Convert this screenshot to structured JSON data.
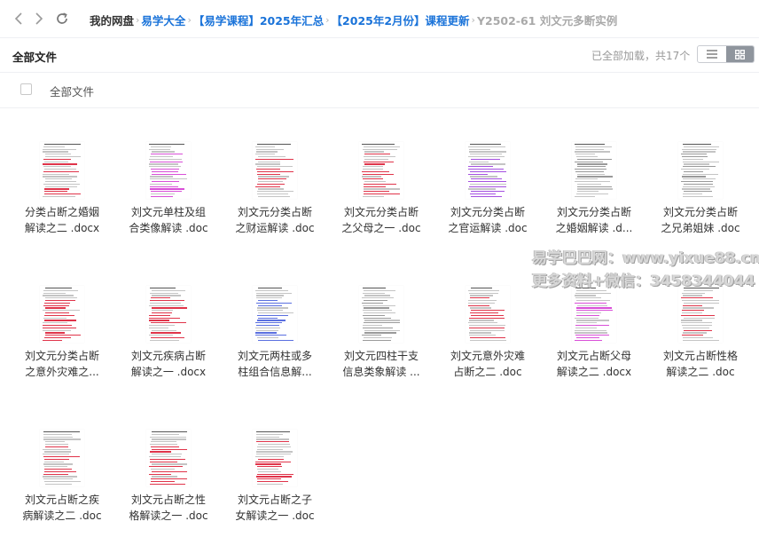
{
  "breadcrumb": [
    {
      "label": "我的网盘",
      "kind": "root"
    },
    {
      "label": "易学大全",
      "kind": "link"
    },
    {
      "label": "【易学课程】2025年汇总",
      "kind": "link"
    },
    {
      "label": "【2025年2月份】课程更新",
      "kind": "link"
    },
    {
      "label": "Y2502-61 刘文元多断实例",
      "kind": "current"
    }
  ],
  "toolbar": {
    "title": "全部文件",
    "status": "已全部加载，共17个"
  },
  "list_header": {
    "label": "全部文件"
  },
  "files": [
    {
      "line1": "分类占断之婚姻",
      "line2": "解读之二 .docx",
      "accent": "red"
    },
    {
      "line1": "刘文元单柱及组",
      "line2": "合类像解读 .doc",
      "accent": "pink"
    },
    {
      "line1": "刘文元分类占断",
      "line2": "之财运解读 .doc",
      "accent": "red"
    },
    {
      "line1": "刘文元分类占断",
      "line2": "之父母之一 .doc",
      "accent": "red"
    },
    {
      "line1": "刘文元分类占断",
      "line2": "之官运解读 .doc",
      "accent": "purple"
    },
    {
      "line1": "刘文元分类占断",
      "line2": "之婚姻解读 .d...",
      "accent": "gray"
    },
    {
      "line1": "刘文元分类占断",
      "line2": "之兄弟姐妹 .doc",
      "accent": "gray"
    },
    {
      "line1": "刘文元分类占断",
      "line2": "之意外灾难之...",
      "accent": "red"
    },
    {
      "line1": "刘文元疾病占断",
      "line2": "解读之一 .docx",
      "accent": "red"
    },
    {
      "line1": "刘文元两柱或多",
      "line2": "柱组合信息解...",
      "accent": "blue"
    },
    {
      "line1": "刘文元四柱干支",
      "line2": "信息类象解读 ...",
      "accent": "gray"
    },
    {
      "line1": "刘文元意外灾难",
      "line2": "占断之二 .doc",
      "accent": "red"
    },
    {
      "line1": "刘文元占断父母",
      "line2": "解读之二 .docx",
      "accent": "pink"
    },
    {
      "line1": "刘文元占断性格",
      "line2": "解读之二 .doc",
      "accent": "red"
    },
    {
      "line1": "刘文元占断之疾",
      "line2": "病解读之二 .doc",
      "accent": "red"
    },
    {
      "line1": "刘文元占断之性",
      "line2": "格解读之一 .doc",
      "accent": "red"
    },
    {
      "line1": "刘文元占断之子",
      "line2": "女解读之一 .doc",
      "accent": "red"
    }
  ],
  "watermark": {
    "line1": "易学巴巴网：www.yixue88.cn",
    "line2": "更多资料+微信：3458344044"
  },
  "colors": {
    "link": "#1a73d9",
    "red": "#e0344a",
    "pink": "#d94fd8",
    "purple": "#a550e0",
    "blue": "#5a6fe0",
    "gray": "#9a9a9a"
  }
}
